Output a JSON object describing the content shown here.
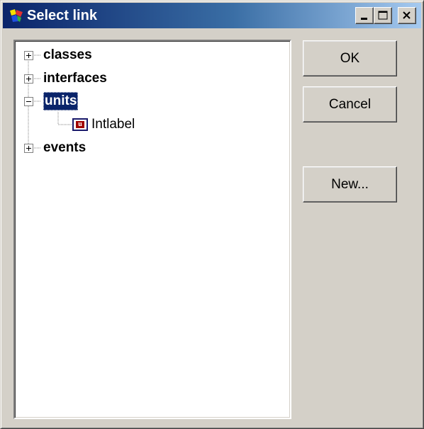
{
  "window": {
    "title": "Select link",
    "title_icon": "delphi-project-icon",
    "colors": {
      "titlebar_start": "#0a246a",
      "titlebar_end": "#a6caf0",
      "face": "#d4d0c8",
      "selection": "#0a246a"
    }
  },
  "tree": {
    "nodes": [
      {
        "label": "classes",
        "expander": "plus",
        "selected": false
      },
      {
        "label": "interfaces",
        "expander": "plus",
        "selected": false
      },
      {
        "label": "units",
        "expander": "minus",
        "selected": true,
        "children": [
          {
            "label": "Intlabel",
            "icon": "unit-icon",
            "icon_letter": "u"
          }
        ]
      },
      {
        "label": "events",
        "expander": "plus",
        "selected": false
      }
    ]
  },
  "buttons": {
    "ok": "OK",
    "cancel": "Cancel",
    "new": "New..."
  }
}
